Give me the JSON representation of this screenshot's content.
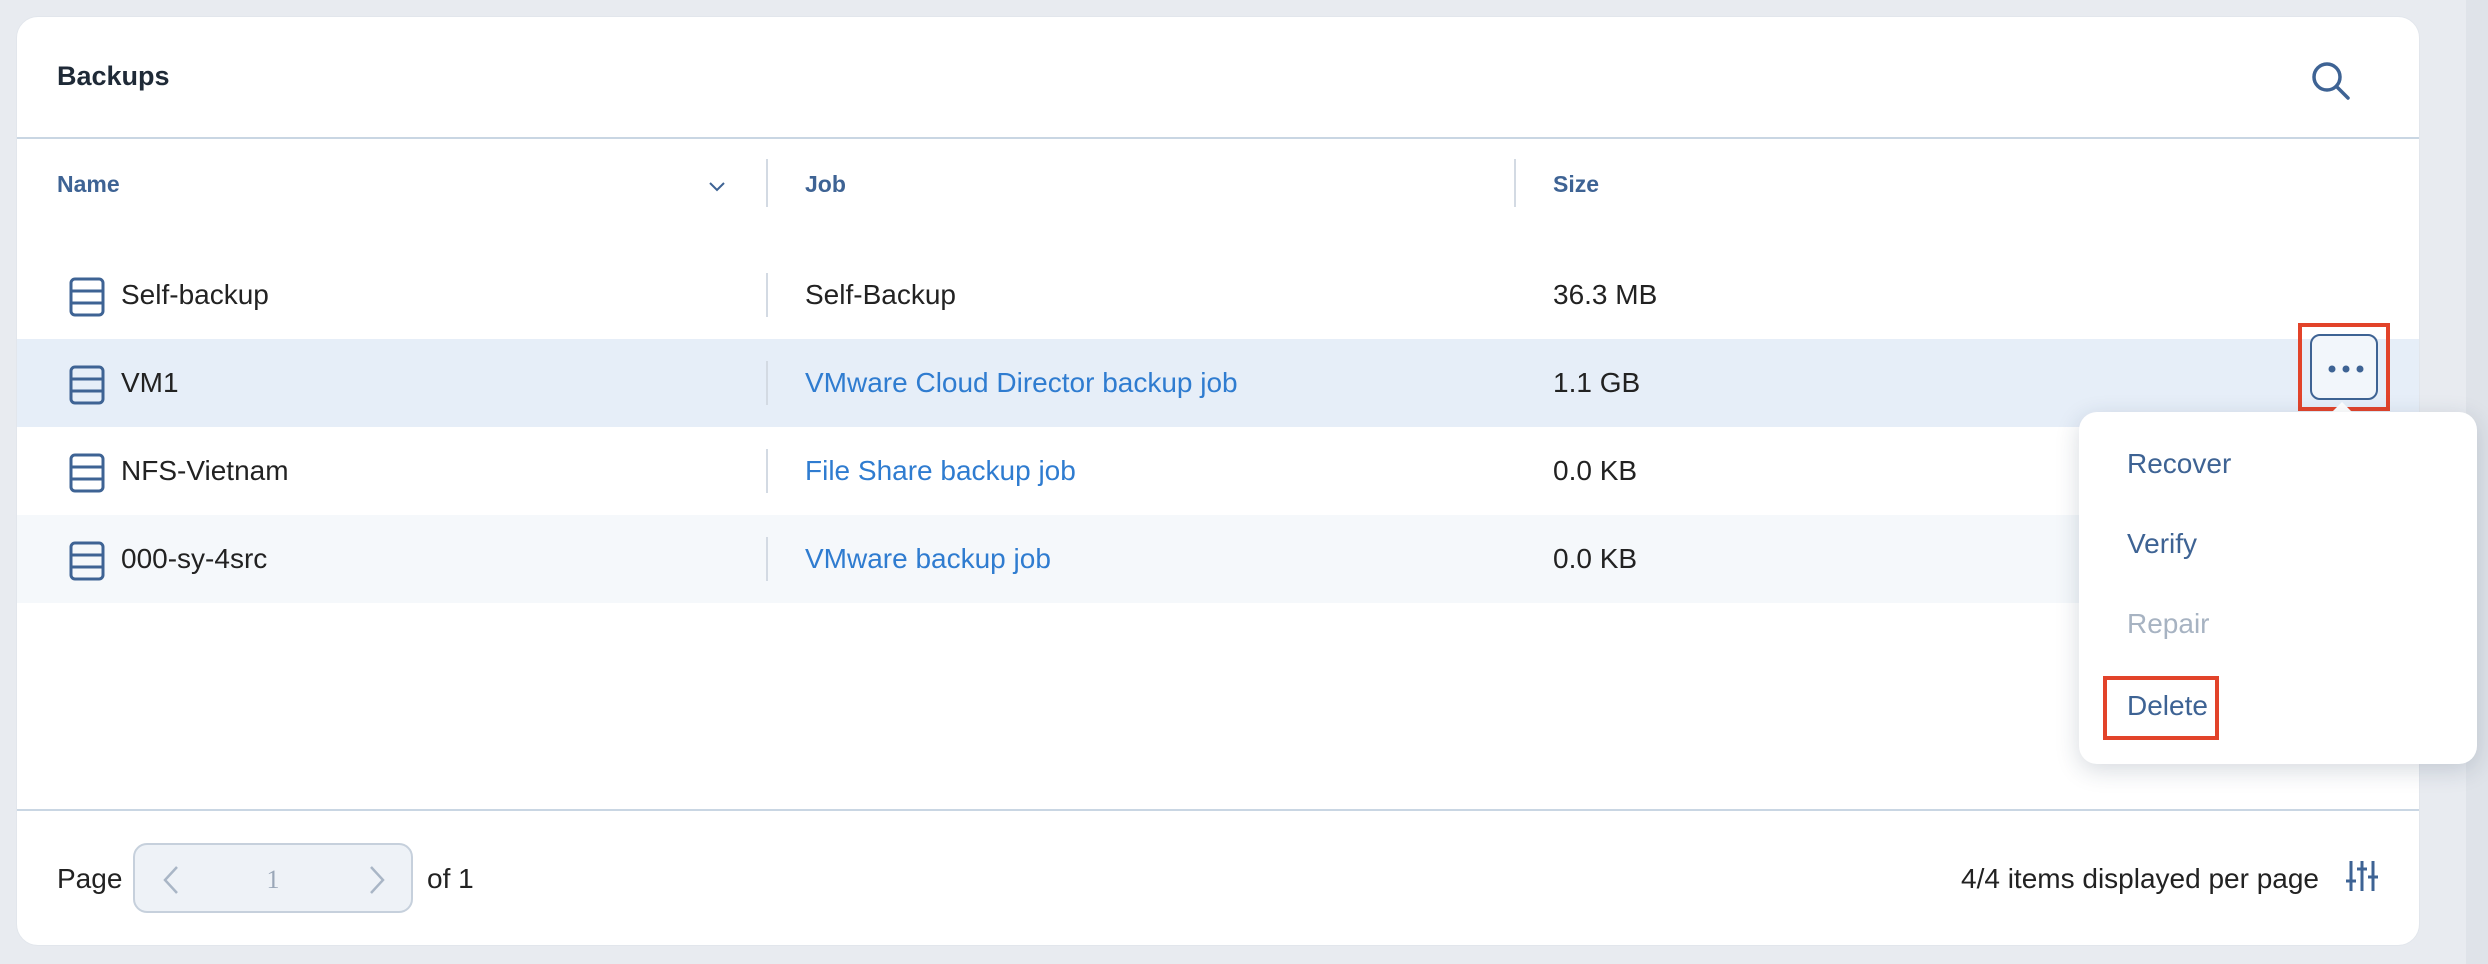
{
  "panel": {
    "title": "Backups",
    "search_icon": "search-icon"
  },
  "table": {
    "columns": [
      {
        "label": "Name"
      },
      {
        "label": "Job"
      },
      {
        "label": "Size"
      }
    ],
    "rows": [
      {
        "name": "Self-backup",
        "job": "Self-Backup",
        "job_is_link": false,
        "size": "36.3 MB"
      },
      {
        "name": "VM1",
        "job": "VMware Cloud Director backup job",
        "job_is_link": true,
        "size": "1.1 GB"
      },
      {
        "name": "NFS-Vietnam",
        "job": "File Share backup job",
        "job_is_link": true,
        "size": "0.0 KB"
      },
      {
        "name": "000-sy-4src",
        "job": "VMware backup job",
        "job_is_link": true,
        "size": "0.0 KB"
      }
    ]
  },
  "context_menu": {
    "items": [
      {
        "label": "Recover",
        "disabled": false
      },
      {
        "label": "Verify",
        "disabled": false
      },
      {
        "label": "Repair",
        "disabled": true
      },
      {
        "label": "Delete",
        "disabled": false,
        "highlighted": true
      }
    ]
  },
  "footer": {
    "page_label": "Page",
    "page_value": "1",
    "of_label": "of 1",
    "per_page_label": "4/4 items displayed per page"
  },
  "colors": {
    "accent": "#3e6394",
    "link": "#2f7cd0",
    "highlight_border": "#e2432a",
    "selected_row": "#e6eef8"
  }
}
